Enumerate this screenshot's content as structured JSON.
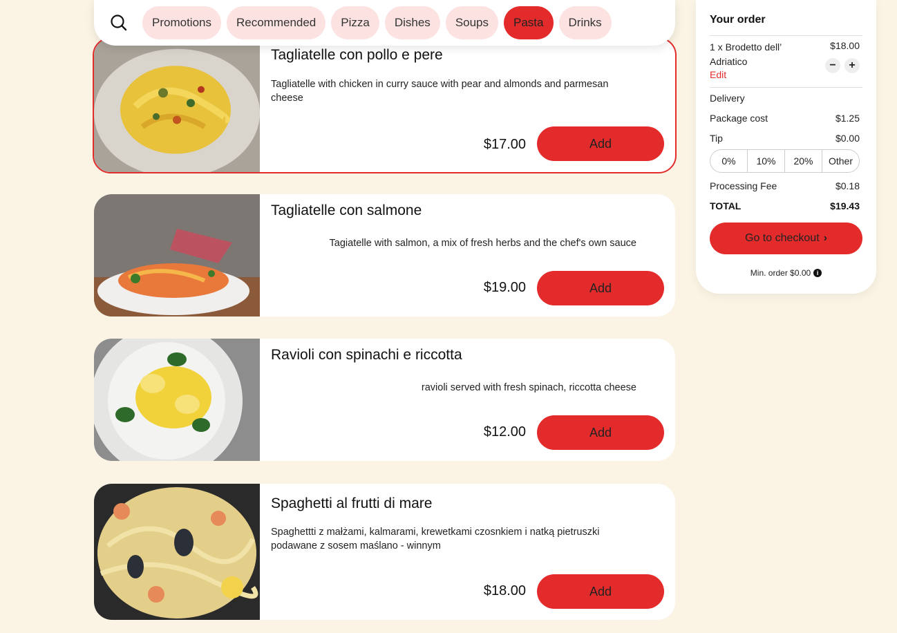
{
  "categories": {
    "items": [
      "Promotions",
      "Recommended",
      "Pizza",
      "Dishes",
      "Soups",
      "Pasta",
      "Drinks"
    ],
    "active": "Pasta"
  },
  "products": [
    {
      "name": "Tagliatelle con pollo e pere",
      "description": "Tagliatelle with chicken in curry sauce with pear and almonds and parmesan cheese",
      "price": "$17.00",
      "button": "Add"
    },
    {
      "name": "Tagliatelle con salmone",
      "description": "Tagiatelle with salmon, a mix of fresh herbs and the chef's own sauce",
      "price": "$19.00",
      "button": "Add"
    },
    {
      "name": "Ravioli con spinachi e riccotta",
      "description": "ravioli served with fresh spinach, riccotta cheese",
      "price": "$12.00",
      "button": "Add"
    },
    {
      "name": "Spaghetti al frutti di mare",
      "description": "Spaghettti z małżami, kalmarami, krewetkami czosnkiem i natką pietruszki podawane z sosem maślano - winnym",
      "price": "$18.00",
      "button": "Add"
    }
  ],
  "order": {
    "title": "Your order",
    "item": {
      "name": "1 x Brodetto dell’ Adriatico",
      "price": "$18.00",
      "edit": "Edit"
    },
    "delivery_label": "Delivery",
    "package_label": "Package cost",
    "package_value": "$1.25",
    "tip_label": "Tip",
    "tip_value": "$0.00",
    "tip_options": [
      "0%",
      "10%",
      "20%",
      "Other"
    ],
    "fee_label": "Processing Fee",
    "fee_value": "$0.18",
    "total_label": "TOTAL",
    "total_value": "$19.43",
    "checkout": "Go to checkout",
    "min_order": "Min. order $0.00"
  },
  "colors": {
    "accent": "#e32b2b",
    "chip": "#fde2e2",
    "background": "#fbf4e4"
  }
}
